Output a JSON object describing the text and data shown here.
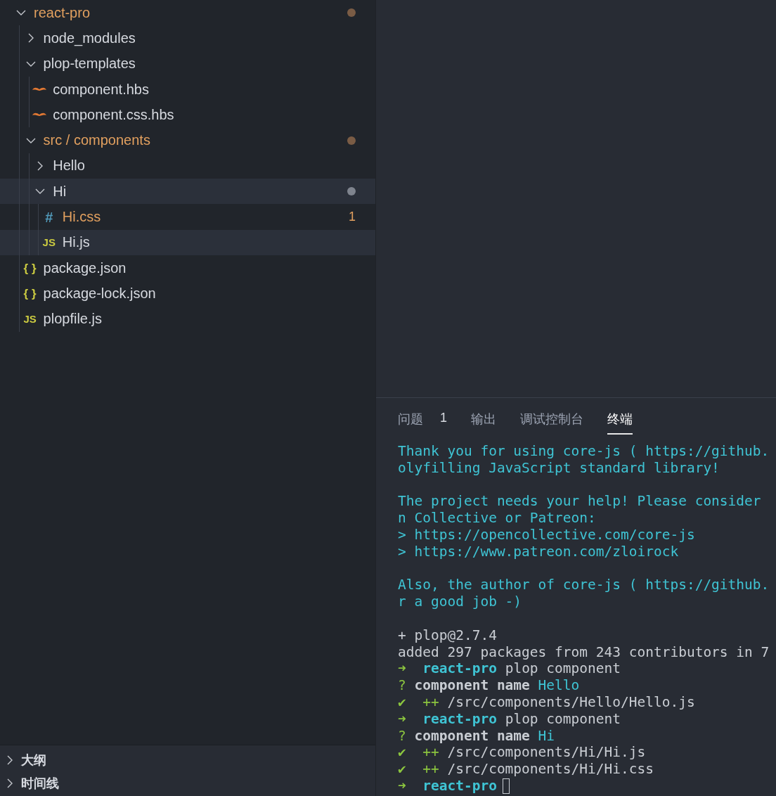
{
  "explorer": {
    "tree": [
      {
        "name": "react-pro",
        "kind": "folder",
        "expanded": true,
        "modified": true,
        "selected": false,
        "color": "#7a5c45",
        "children": [
          {
            "name": "node_modules",
            "kind": "folder",
            "expanded": false,
            "modified": false,
            "selected": false
          },
          {
            "name": "plop-templates",
            "kind": "folder",
            "expanded": true,
            "modified": false,
            "selected": false,
            "children": [
              {
                "name": "component.hbs",
                "kind": "hbs",
                "modified": false,
                "selected": false
              },
              {
                "name": "component.css.hbs",
                "kind": "hbs",
                "modified": false,
                "selected": false
              }
            ]
          },
          {
            "name": "src / components",
            "kind": "folder",
            "expanded": true,
            "modified": true,
            "selected": false,
            "color": "#7a5c45",
            "children": [
              {
                "name": "Hello",
                "kind": "folder",
                "expanded": false,
                "modified": false,
                "selected": false
              },
              {
                "name": "Hi",
                "kind": "folder",
                "expanded": true,
                "modified": false,
                "selected": true,
                "color": "#7f848e",
                "children": [
                  {
                    "name": "Hi.css",
                    "kind": "css",
                    "icon": "#",
                    "modified": true,
                    "selected": false,
                    "badge": "1"
                  },
                  {
                    "name": "Hi.js",
                    "kind": "js",
                    "icon": "JS",
                    "modified": false,
                    "selected": true
                  }
                ]
              }
            ]
          },
          {
            "name": "package.json",
            "kind": "json",
            "icon": "{ }",
            "modified": false,
            "selected": false
          },
          {
            "name": "package-lock.json",
            "kind": "json",
            "icon": "{ }",
            "modified": false,
            "selected": false
          },
          {
            "name": "plopfile.js",
            "kind": "js",
            "icon": "JS",
            "modified": false,
            "selected": false
          }
        ]
      }
    ],
    "sections": [
      {
        "title": "大纲",
        "expanded": false
      },
      {
        "title": "时间线",
        "expanded": false
      }
    ]
  },
  "panel": {
    "tabs": [
      {
        "label": "问题",
        "badge": "1",
        "selected": false
      },
      {
        "label": "输出",
        "selected": false
      },
      {
        "label": "调试控制台",
        "selected": false
      },
      {
        "label": "终端",
        "selected": true
      }
    ],
    "terminal": [
      [
        [
          {
            "kind": "info",
            "text": "Thank you for using core-js ( https://github."
          }
        ],
        [
          {
            "kind": "info",
            "text": "olyfilling JavaScript standard library!"
          }
        ]
      ],
      [
        [
          {
            "kind": "info",
            "text": "The project needs your help! Please consider "
          }
        ],
        [
          {
            "kind": "info",
            "text": "n Collective or Patreon:"
          }
        ],
        [
          {
            "kind": "info",
            "text": "> https://opencollective.com/core-js"
          }
        ],
        [
          {
            "kind": "info",
            "text": "> https://www.patreon.com/zloirock"
          }
        ]
      ],
      [
        [
          {
            "kind": "info",
            "text": "Also, the author of core-js ( https://github."
          }
        ],
        [
          {
            "kind": "info",
            "text": "r a good job -)"
          }
        ]
      ],
      [
        [
          {
            "kind": "plain",
            "text": "+ plop@2.7.4"
          }
        ],
        [
          {
            "kind": "plain",
            "text": "added 297 packages from 243 contributors in 7"
          }
        ],
        [
          {
            "kind": "success",
            "text": "➜  "
          },
          {
            "kind": "dir",
            "text": "react-pro"
          },
          {
            "kind": "plain",
            "text": " plop component"
          }
        ],
        [
          {
            "kind": "success",
            "text": "? "
          },
          {
            "kind": "bold",
            "text": "component name"
          },
          {
            "kind": "value",
            "text": " Hello"
          }
        ],
        [
          {
            "kind": "success",
            "text": "✔  ++"
          },
          {
            "kind": "plain",
            "text": " /src/components/Hello/Hello.js"
          }
        ],
        [
          {
            "kind": "success",
            "text": "➜  "
          },
          {
            "kind": "dir",
            "text": "react-pro"
          },
          {
            "kind": "plain",
            "text": " plop component"
          }
        ],
        [
          {
            "kind": "success",
            "text": "? "
          },
          {
            "kind": "bold",
            "text": "component name"
          },
          {
            "kind": "value",
            "text": " Hi"
          }
        ],
        [
          {
            "kind": "success",
            "text": "✔  ++"
          },
          {
            "kind": "plain",
            "text": " /src/components/Hi/Hi.js"
          }
        ],
        [
          {
            "kind": "success",
            "text": "✔  ++"
          },
          {
            "kind": "plain",
            "text": " /src/components/Hi/Hi.css"
          }
        ],
        [
          {
            "kind": "success",
            "text": "➜  "
          },
          {
            "kind": "dir",
            "text": "react-pro"
          },
          {
            "kind": "cursor"
          }
        ]
      ]
    ]
  }
}
